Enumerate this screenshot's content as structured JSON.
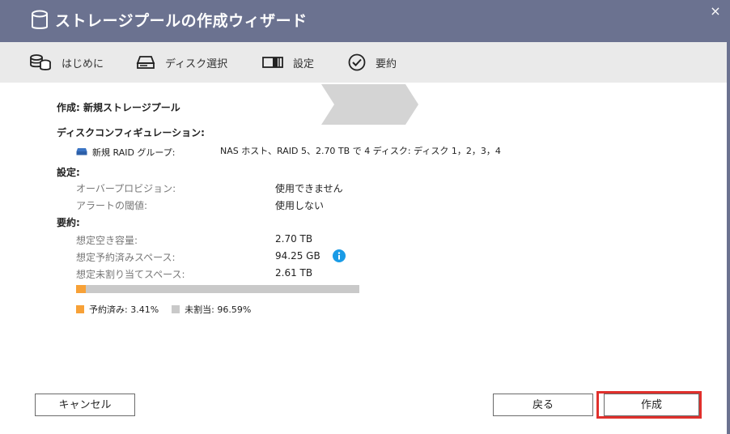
{
  "window": {
    "title": "ストレージプールの作成ウィザード",
    "close_label": "×"
  },
  "steps": [
    {
      "label": "はじめに",
      "icon": "database-icon"
    },
    {
      "label": "ディスク選択",
      "icon": "disk-drive-icon"
    },
    {
      "label": "設定",
      "icon": "settings-bar-icon"
    },
    {
      "label": "要約",
      "icon": "check-circle-icon",
      "active": true
    }
  ],
  "summary": {
    "create_heading": "作成: 新規ストレージプール",
    "disk_config_heading": "ディスクコンフィギュレーション:",
    "raid_group_label": "新規 RAID グループ:",
    "raid_group_value": "NAS ホスト、RAID 5、2.70 TB で 4 ディスク: ディスク 1，2，3，4",
    "settings_heading": "設定:",
    "overprovision_label": "オーバープロビジョン:",
    "overprovision_value": "使用できません",
    "alert_label": "アラートの閾値:",
    "alert_value": "使用しない",
    "summary_heading": "要約:",
    "free_label": "想定空き容量:",
    "free_value": "2.70 TB",
    "reserved_label": "想定予約済みスペース:",
    "reserved_value": "94.25 GB",
    "unallocated_label": "想定未割り当てスペース:",
    "unallocated_value": "2.61 TB"
  },
  "usage": {
    "reserved_percent": 3.41,
    "reserved_legend": "予約済み: 3.41%",
    "unallocated_legend": "未割当: 96.59%",
    "reserved_color": "#f7a137",
    "unallocated_color": "#c9c9c9"
  },
  "buttons": {
    "cancel": "キャンセル",
    "back": "戻る",
    "create": "作成"
  },
  "colors": {
    "titlebar": "#6b7290",
    "highlight": "#e0302c",
    "info": "#1a9be6"
  }
}
